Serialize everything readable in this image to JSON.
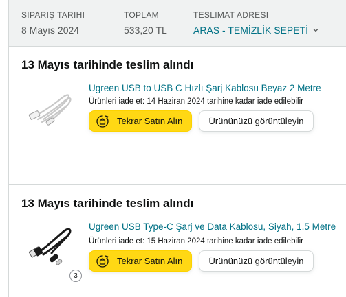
{
  "order_header": {
    "order_date_label": "Sipariş tarihi",
    "order_date": "8 Mayıs 2024",
    "total_label": "Toplam",
    "total": "533,20 TL",
    "ship_to_label": "Teslimat adresi",
    "ship_to": "ARAS - TEMİZLİK SEPETİ",
    "ship_to_icon": "chevron-down-icon"
  },
  "shipments": [
    {
      "status": "13 Mayıs tarihinde teslim alındı",
      "product_title": "Ugreen USB to USB C Hızlı Şarj Kablosu Beyaz 2 Metre",
      "return_text": "Ürünleri iade et: 14 Haziran 2024 tarihine kadar iade edilebilir",
      "buy_again_label": "Tekrar Satın Alın",
      "view_item_label": "Ürününüzü görüntüleyin",
      "image_icon": "white-usb-cable-icon"
    },
    {
      "status": "13 Mayıs tarihinde teslim alındı",
      "product_title": "Ugreen USB Type-C Şarj ve Data Kablosu, Siyah, 1.5 Metre",
      "return_text": "Ürünleri iade et: 15 Haziran 2024 tarihine kadar iade edilebilir",
      "buy_again_label": "Tekrar Satın Alın",
      "view_item_label": "Ürününüzü görüntüleyin",
      "image_icon": "black-usb-cable-icon",
      "quantity": "3"
    }
  ],
  "colors": {
    "link": "#007185",
    "buy_button": "#ffd814",
    "header_bg": "#f0f2f2"
  }
}
